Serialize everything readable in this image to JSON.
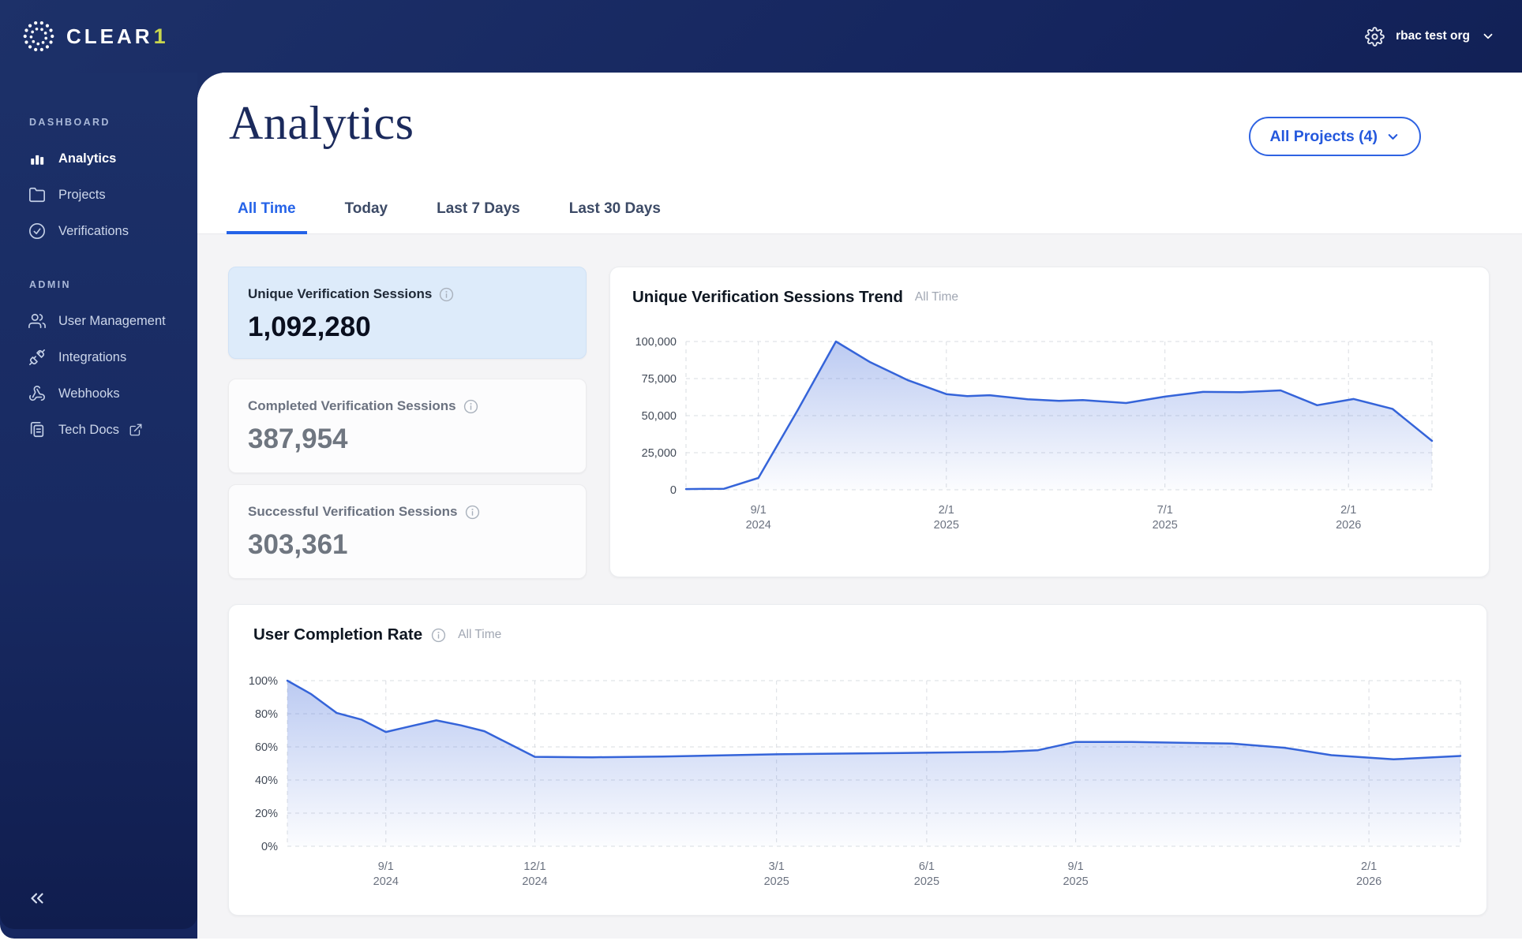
{
  "topbar": {
    "logo_text": "CLEAR",
    "logo_accent": "1",
    "org_name": "rbac test org"
  },
  "sidebar": {
    "sections": [
      {
        "label": "DASHBOARD",
        "items": [
          {
            "label": "Analytics"
          },
          {
            "label": "Projects"
          },
          {
            "label": "Verifications"
          }
        ]
      },
      {
        "label": "ADMIN",
        "items": [
          {
            "label": "User Management"
          },
          {
            "label": "Integrations"
          },
          {
            "label": "Webhooks"
          },
          {
            "label": "Tech Docs"
          }
        ]
      }
    ]
  },
  "header": {
    "title": "Analytics",
    "projects_button_label": "All Projects (4)"
  },
  "tabs": [
    {
      "label": "All Time"
    },
    {
      "label": "Today"
    },
    {
      "label": "Last 7 Days"
    },
    {
      "label": "Last 30 Days"
    }
  ],
  "stat_cards": [
    {
      "label": "Unique Verification Sessions",
      "value": "1,092,280"
    },
    {
      "label": "Completed Verification Sessions",
      "value": "387,954"
    },
    {
      "label": "Successful Verification Sessions",
      "value": "303,361"
    }
  ],
  "colors": {
    "accent_blue": "#2563e8",
    "navy": "#15255e",
    "logo_accent": "#c9d64d",
    "chart_line": "#3564d9"
  },
  "chart_data": [
    {
      "type": "area",
      "title": "Unique Verification Sessions Trend",
      "subtitle": "All Time",
      "ylim": [
        0,
        100000
      ],
      "grid": "dashed",
      "legend": "none",
      "y_ticks": [
        {
          "value": 0,
          "label": "0"
        },
        {
          "value": 25000,
          "label": "25,000"
        },
        {
          "value": 50000,
          "label": "50,000"
        },
        {
          "value": 75000,
          "label": "75,000"
        },
        {
          "value": 100000,
          "label": "100,000"
        }
      ],
      "x_ticks": [
        {
          "pos": 0.097,
          "label": "9/1",
          "sublabel": "2024"
        },
        {
          "pos": 0.349,
          "label": "2/1",
          "sublabel": "2025"
        },
        {
          "pos": 0.642,
          "label": "7/1",
          "sublabel": "2025"
        },
        {
          "pos": 0.888,
          "label": "2/1",
          "sublabel": "2026"
        }
      ],
      "points": [
        [
          0.0,
          500
        ],
        [
          0.051,
          700
        ],
        [
          0.097,
          8000
        ],
        [
          0.15,
          54000
        ],
        [
          0.201,
          100000
        ],
        [
          0.247,
          86000
        ],
        [
          0.297,
          74000
        ],
        [
          0.349,
          64500
        ],
        [
          0.377,
          63200
        ],
        [
          0.407,
          63800
        ],
        [
          0.458,
          61000
        ],
        [
          0.5,
          60000
        ],
        [
          0.532,
          60500
        ],
        [
          0.59,
          58500
        ],
        [
          0.642,
          62800
        ],
        [
          0.693,
          66000
        ],
        [
          0.744,
          65800
        ],
        [
          0.797,
          67000
        ],
        [
          0.846,
          57000
        ],
        [
          0.895,
          61200
        ],
        [
          0.947,
          54600
        ],
        [
          1.0,
          33000
        ]
      ]
    },
    {
      "type": "area",
      "title": "User Completion Rate",
      "subtitle": "All Time",
      "ylim": [
        0,
        100
      ],
      "grid": "dashed",
      "legend": "none",
      "y_ticks": [
        {
          "value": 0,
          "label": "0%"
        },
        {
          "value": 20,
          "label": "20%"
        },
        {
          "value": 40,
          "label": "40%"
        },
        {
          "value": 60,
          "label": "60%"
        },
        {
          "value": 80,
          "label": "80%"
        },
        {
          "value": 100,
          "label": "100%"
        }
      ],
      "x_ticks": [
        {
          "pos": 0.084,
          "label": "9/1",
          "sublabel": "2024"
        },
        {
          "pos": 0.211,
          "label": "12/1",
          "sublabel": "2024"
        },
        {
          "pos": 0.417,
          "label": "3/1",
          "sublabel": "2025"
        },
        {
          "pos": 0.545,
          "label": "6/1",
          "sublabel": "2025"
        },
        {
          "pos": 0.672,
          "label": "9/1",
          "sublabel": "2025"
        },
        {
          "pos": 0.922,
          "label": "2/1",
          "sublabel": "2026"
        }
      ],
      "points": [
        [
          0.0,
          100
        ],
        [
          0.02,
          92
        ],
        [
          0.042,
          80.5
        ],
        [
          0.063,
          76.5
        ],
        [
          0.084,
          69
        ],
        [
          0.105,
          72.5
        ],
        [
          0.127,
          76
        ],
        [
          0.148,
          73
        ],
        [
          0.168,
          69.5
        ],
        [
          0.19,
          61.5
        ],
        [
          0.211,
          54
        ],
        [
          0.26,
          53.7
        ],
        [
          0.32,
          54.2
        ],
        [
          0.417,
          55.5
        ],
        [
          0.48,
          56
        ],
        [
          0.545,
          56.5
        ],
        [
          0.61,
          57
        ],
        [
          0.64,
          58
        ],
        [
          0.672,
          63
        ],
        [
          0.72,
          63
        ],
        [
          0.805,
          62
        ],
        [
          0.85,
          59.5
        ],
        [
          0.89,
          55
        ],
        [
          0.943,
          52.5
        ],
        [
          1.0,
          54.5
        ]
      ]
    }
  ]
}
